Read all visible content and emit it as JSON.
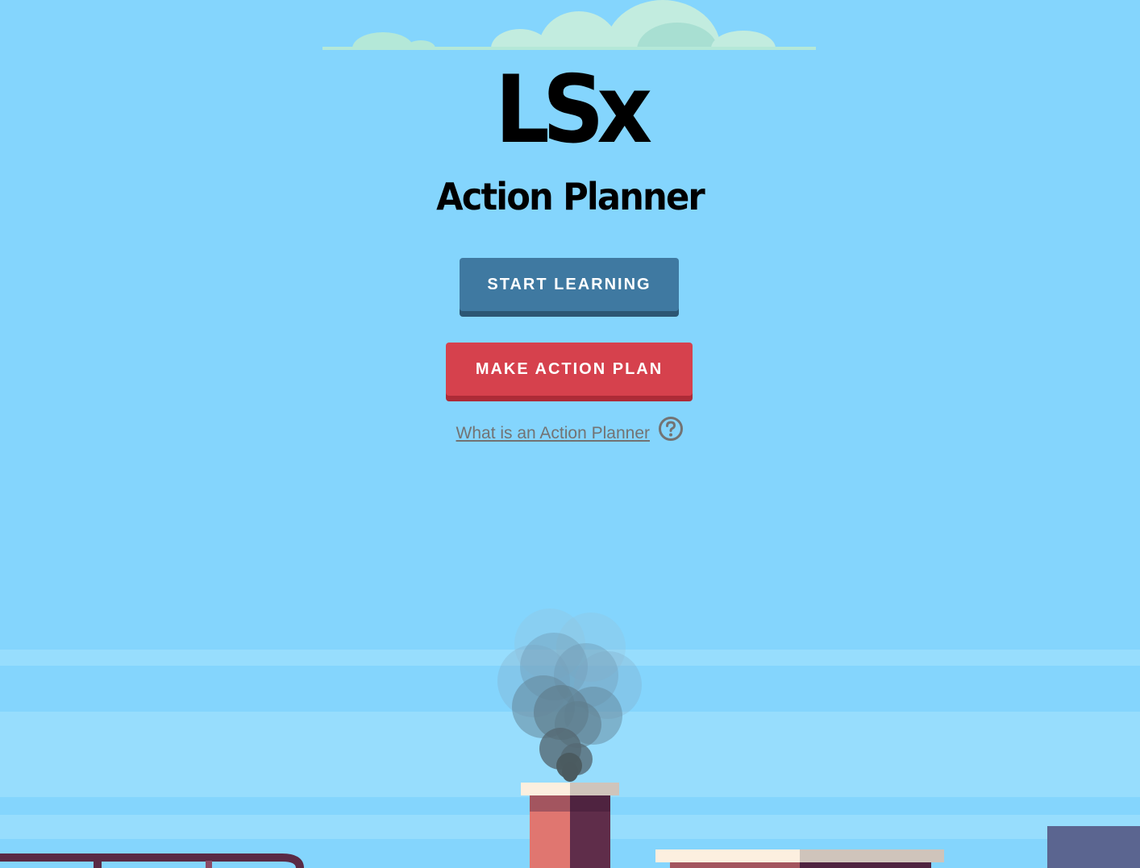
{
  "app": {
    "logo": "LSx",
    "subtitle": "Action Planner"
  },
  "buttons": {
    "start_learning": "START LEARNING",
    "make_action_plan": "MAKE ACTION PLAN"
  },
  "help": {
    "link_text": "What is an Action Planner",
    "icon": "question-circle-icon"
  },
  "colors": {
    "sky": "#84d5fd",
    "start_learning_button": "#3f79a1",
    "make_action_plan_button": "#d6414d",
    "help_text": "#737373"
  }
}
